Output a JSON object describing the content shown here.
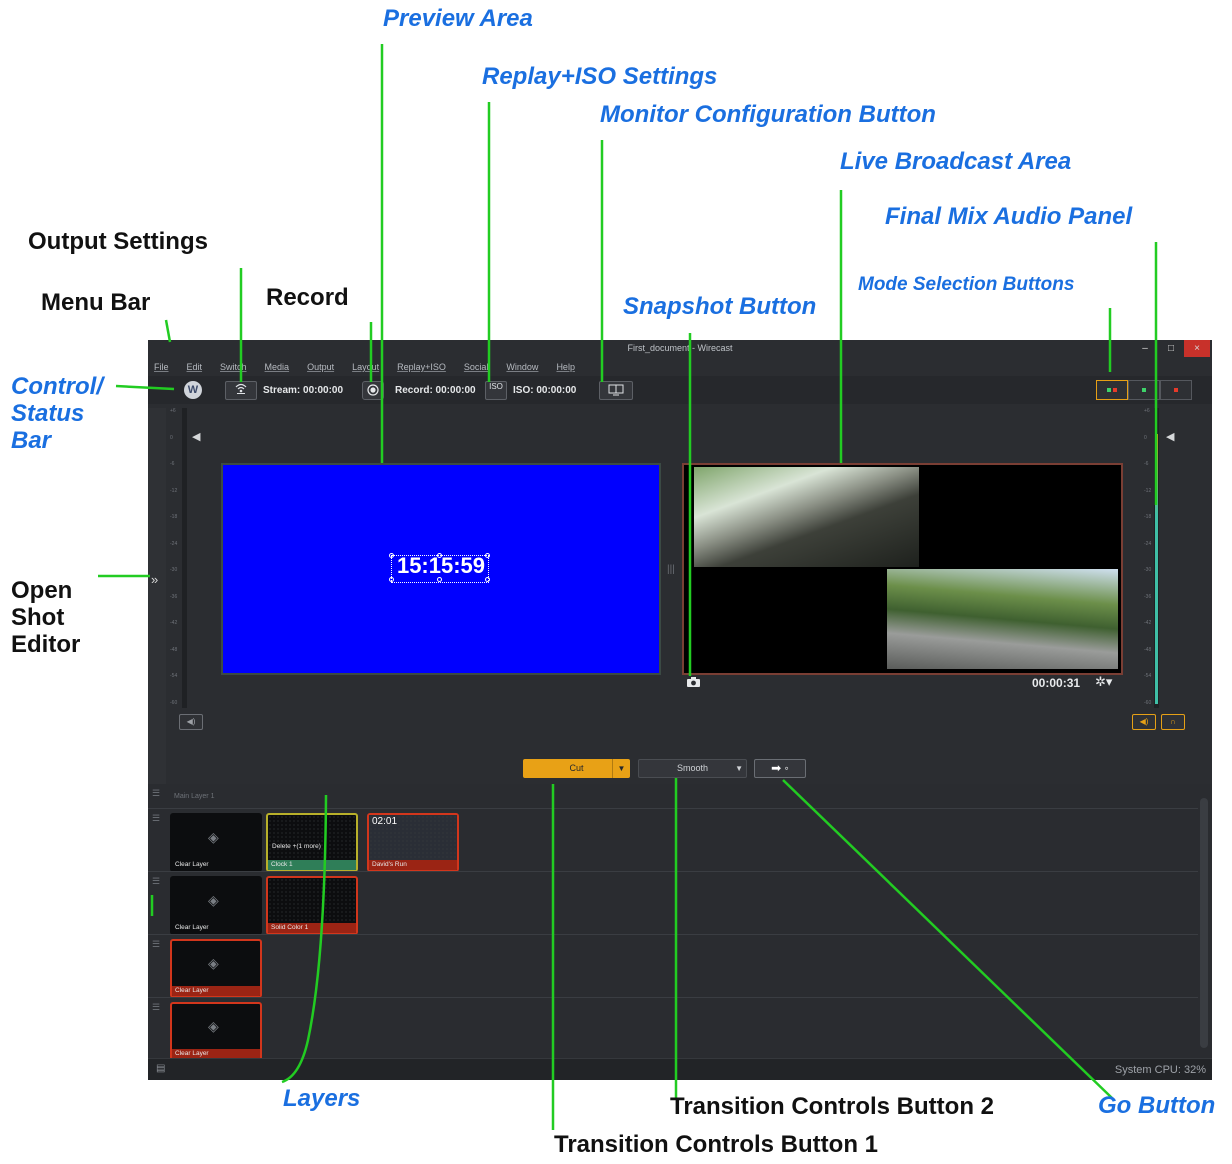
{
  "annotations": {
    "preview_area": "Preview Area",
    "replay_iso_settings": "Replay+ISO Settings",
    "monitor_configuration_button": "Monitor Configuration Button",
    "live_broadcast_area": "Live Broadcast Area",
    "final_mix_audio_panel": "Final Mix Audio Panel",
    "output_settings": "Output Settings",
    "mode_selection_buttons": "Mode Selection Buttons",
    "menu_bar": "Menu Bar",
    "record": "Record",
    "snapshot_button": "Snapshot Button",
    "control_status_bar_1": "Control/",
    "control_status_bar_2": "Status",
    "control_status_bar_3": "Bar",
    "open_shot_editor_1": "Open",
    "open_shot_editor_2": "Shot",
    "open_shot_editor_3": "Editor",
    "layers": "Layers",
    "go_button": "Go Button",
    "transition_controls_button_2": "Transition Controls Button 2",
    "transition_controls_button_1": "Transition Controls Button 1"
  },
  "window": {
    "title": "First_document - Wirecast",
    "minimize": "–",
    "maximize": "□",
    "close": "×"
  },
  "menu": [
    "File",
    "Edit",
    "Switch",
    "Media",
    "Output",
    "Layout",
    "Replay+ISO",
    "Social",
    "Window",
    "Help"
  ],
  "control_bar": {
    "logo": "W",
    "stream_label": "Stream: 00:00:00",
    "record_label": "Record: 00:00:00",
    "iso_button": "ISO",
    "iso_label": "ISO: 00:00:00"
  },
  "meter_scale": [
    "+6",
    "0",
    "-6",
    "-12",
    "-18",
    "-24",
    "-30",
    "-36",
    "-42",
    "-48",
    "-54",
    "-60"
  ],
  "preview": {
    "clock_text": "15:15:59"
  },
  "live": {
    "timecode": "00:00:31"
  },
  "transitions": {
    "cut_label": "Cut",
    "smooth_label": "Smooth"
  },
  "layers": {
    "main_layer_label": "Main Layer 1",
    "shots": {
      "r1_clear": "Clear Layer",
      "r1_clock": "Clock 1",
      "r1_clock_overlay": "Delete +(1 more)",
      "r1_run": "David's Run",
      "r1_run_tc": "02:01",
      "r2_clear": "Clear Layer",
      "r2_solid": "Solid Color 1",
      "r3_clear": "Clear Layer",
      "r4_clear": "Clear Layer"
    }
  },
  "status": {
    "cpu": "System CPU: 32%"
  },
  "colors": {
    "annotation_blue": "#1a6fe0",
    "callout_green": "#22cc22",
    "accent_orange": "#e8a116",
    "live_red": "#d2361c",
    "preview_blue": "#0000ff"
  }
}
